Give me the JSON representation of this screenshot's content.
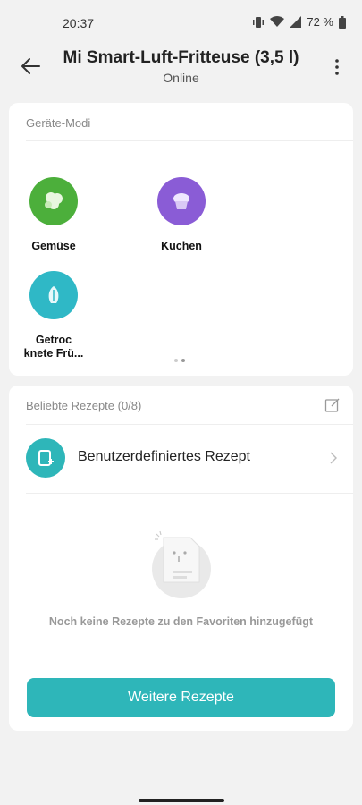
{
  "status_bar": {
    "time": "20:37",
    "battery": "72 %"
  },
  "header": {
    "title": "Mi Smart-Luft-Fritteuse (3,5 l)",
    "status": "Online"
  },
  "modes": {
    "section_title": "Geräte-Modi",
    "items": [
      {
        "label": "Gemüse",
        "icon": "broccoli-icon",
        "color": "#4caf3b"
      },
      {
        "label": "Kuchen",
        "icon": "cupcake-icon",
        "color": "#8a5cd6"
      },
      {
        "label": "Getroc\nknete Frü...",
        "icon": "dried-fruit-icon",
        "color": "#2fb8c6"
      }
    ],
    "page_dots": 2,
    "active_page": 2
  },
  "recipes": {
    "section_title": "Beliebte Rezepte (0/8)",
    "custom_recipe_label": "Benutzerdefiniertes Rezept",
    "empty_text": "Noch keine Rezepte zu den Favoriten hinzugefügt",
    "more_button": "Weitere Rezepte",
    "accent_color": "#2eb6b9"
  }
}
